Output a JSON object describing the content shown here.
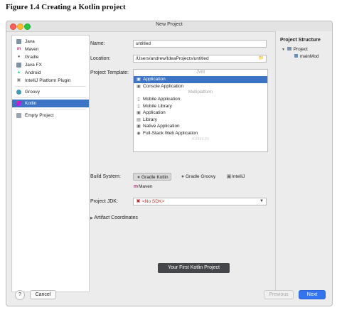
{
  "figure": {
    "caption": "Figure 1.4  Creating a Kotlin project"
  },
  "window": {
    "title": "New Project"
  },
  "sidebar": {
    "items": [
      {
        "label": "Java",
        "icon": "folder-icon"
      },
      {
        "label": "Maven",
        "icon": "maven-icon"
      },
      {
        "label": "Gradle",
        "icon": "gradle-icon"
      },
      {
        "label": "Java FX",
        "icon": "folder-icon"
      },
      {
        "label": "Android",
        "icon": "android-icon"
      },
      {
        "label": "IntelliJ Platform Plugin",
        "icon": "plugin-icon"
      },
      {
        "label": "Groovy",
        "icon": "groovy-icon"
      },
      {
        "label": "Kotlin",
        "icon": "kotlin-icon",
        "selected": true
      },
      {
        "label": "Empty Project",
        "icon": "folder-icon"
      }
    ]
  },
  "form": {
    "name_label": "Name:",
    "name_value": "untitled",
    "location_label": "Location:",
    "location_value": "/Users/andrew/IdeaProjects/untitled",
    "template_label": "Project Template:",
    "build_system_label": "Build System:",
    "jdk_label": "Project JDK:",
    "jdk_value": "<No SDK>",
    "artifact_label": "Artifact Coordinates"
  },
  "templates": {
    "group_jvm": "JVM",
    "group_multiplatform": "Multiplatform",
    "group_kotlinjs": "Kotlin/JS",
    "jvm_items": [
      {
        "label": "Application",
        "selected": true
      },
      {
        "label": "Console Application"
      }
    ],
    "multiplatform_items": [
      {
        "label": "Mobile Application"
      },
      {
        "label": "Mobile Library"
      },
      {
        "label": "Application"
      },
      {
        "label": "Library"
      },
      {
        "label": "Native Application"
      },
      {
        "label": "Full-Stack Web Application"
      }
    ]
  },
  "build_systems": [
    {
      "label": "Gradle Kotlin",
      "selected": true
    },
    {
      "label": "Gradle Groovy"
    },
    {
      "label": "IntelliJ"
    },
    {
      "label": "Maven"
    }
  ],
  "project_structure": {
    "title": "Project Structure",
    "root": "Project",
    "child": "mainMod"
  },
  "tooltip": "Your First Kotlin Project",
  "buttons": {
    "help": "?",
    "cancel": "Cancel",
    "previous": "Previous",
    "next": "Next"
  }
}
